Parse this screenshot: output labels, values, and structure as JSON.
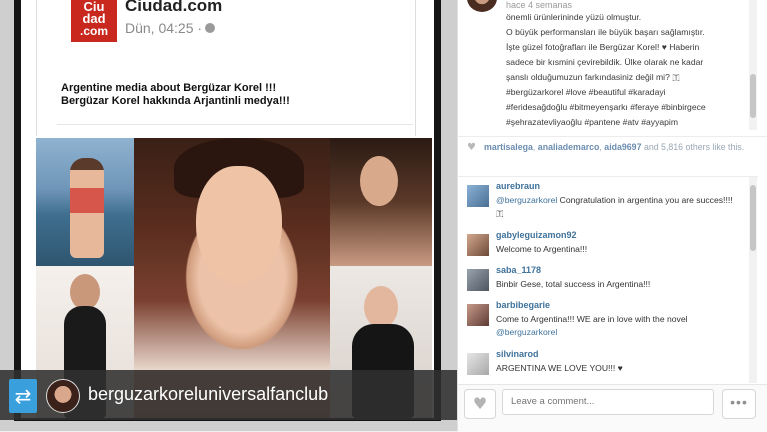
{
  "facebook_post": {
    "logo_lines": [
      "Ciu",
      "dad",
      ".com"
    ],
    "source": "Ciudad.com",
    "time": "Dün, 04:25 ·",
    "caption_lines": [
      "Argentine media about Bergüzar Korel !!!",
      "Bergüzar Korel hakkında Arjantinli medya!!!"
    ]
  },
  "repost": {
    "icon": "repost-icon",
    "username": "berguzarkoreluniversalfanclub"
  },
  "post_caption": {
    "time": "hace 4 semanas",
    "lines": [
      "önemli ürünlerininde yüzü olmuştur.",
      "O büyük performansları ile büyük başarı sağlamıştır.",
      "İşte güzel fotoğrafları ile Bergüzar Korel! ♥ Haberin",
      "sadece bir kısmini çevirebildik. Ülke olarak ne kadar",
      "şanslı olduğumuzun farkındasiniz değil mi? 🇹",
      "#bergüzarkorel #love #beautiful #karadayi",
      "#feridesağdoğlu #bitmeyenşarkı #feraye #binbirgece",
      "#şehrazatevliyaoğlu #pantene #atv #ayyapim"
    ]
  },
  "likes": {
    "users": [
      "martisalega",
      "analiademarco",
      "aida9697"
    ],
    "count_text": "and 5,816 others like this."
  },
  "comments": [
    {
      "user": "aurebraun",
      "mention": "@berguzarkorel",
      "text": " Congratulation in argentina you are succes!!!! 🇹"
    },
    {
      "user": "gabyleguizamon92",
      "mention": "",
      "text": "Welcome to Argentina!!!"
    },
    {
      "user": "saba_1178",
      "mention": "",
      "text": "Binbir Gese, total success in Argentina!!!"
    },
    {
      "user": "barbibegarie",
      "mention": "@berguzarkorel",
      "text": "Come to Argentina!!! WE are in love with the novel "
    },
    {
      "user": "silvinarod",
      "mention": "",
      "text": "ARGENTINA WE LOVE YOU!!! ♥"
    }
  ],
  "footer": {
    "like_icon": "heart-icon",
    "comment_placeholder": "Leave a comment...",
    "more_label": "•••"
  },
  "colors": {
    "link_blue": "#3f729b",
    "repost_blue": "#3aa0dd",
    "logo_red": "#c8281e"
  }
}
